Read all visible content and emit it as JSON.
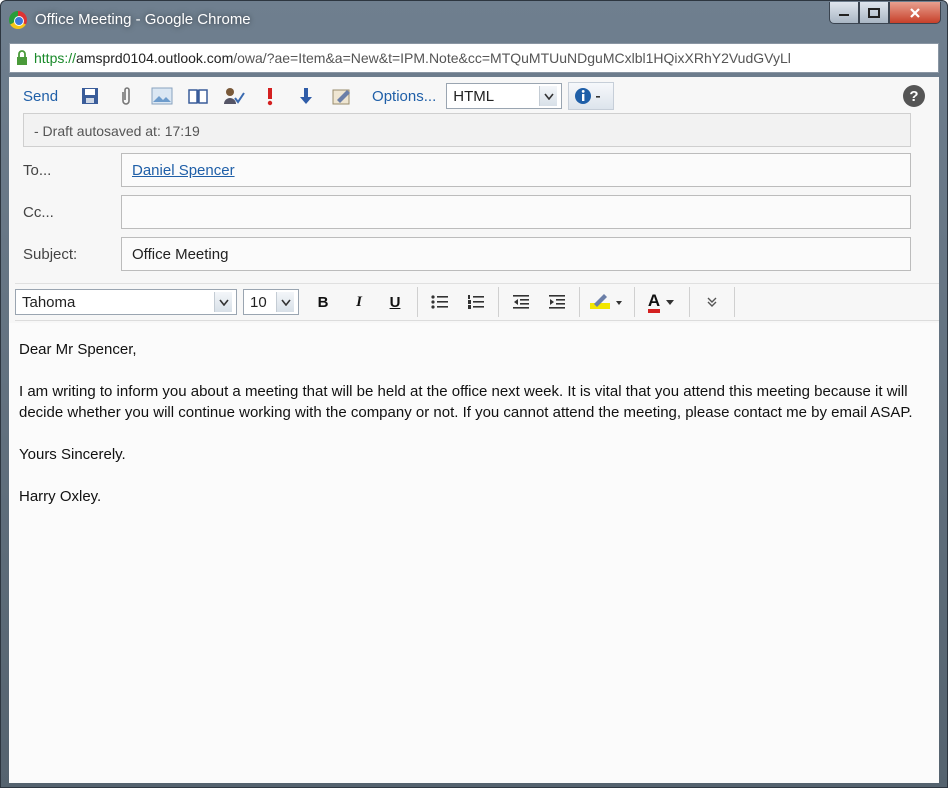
{
  "window": {
    "title": "Office Meeting - Google Chrome",
    "url_secure": "https://",
    "url_host": "amsprd0104.outlook.com",
    "url_rest": "/owa/?ae=Item&a=New&t=IPM.Note&cc=MTQuMTUuNDguMCxlbl1HQixXRhY2VudGVyLl"
  },
  "toolbar": {
    "send_label": "Send",
    "options_label": "Options...",
    "format_select": "HTML"
  },
  "info_bar": {
    "text": "- Draft autosaved at: 17:19"
  },
  "fields": {
    "to_label": "To...",
    "to_value": "Daniel Spencer",
    "cc_label": "Cc...",
    "cc_value": "",
    "subject_label": "Subject:",
    "subject_value": "Office Meeting"
  },
  "formatting": {
    "font": "Tahoma",
    "size": "10",
    "bold": "B",
    "italic": "I",
    "underline": "U",
    "font_color_glyph": "A"
  },
  "message": {
    "greeting": "Dear Mr Spencer,",
    "paragraph": "I am writing to inform you about a meeting that will be held at the office next week. It is vital that you attend this meeting because it will decide whether you will continue working with the company or not. If you cannot attend the meeting, please contact me by email ASAP.",
    "closing": "Yours Sincerely.",
    "signature": "Harry Oxley."
  },
  "colors": {
    "link": "#1f5fa8",
    "secure": "#1a8a2a",
    "font_color_underline": "#d42020",
    "highlight": "#f2e600"
  }
}
